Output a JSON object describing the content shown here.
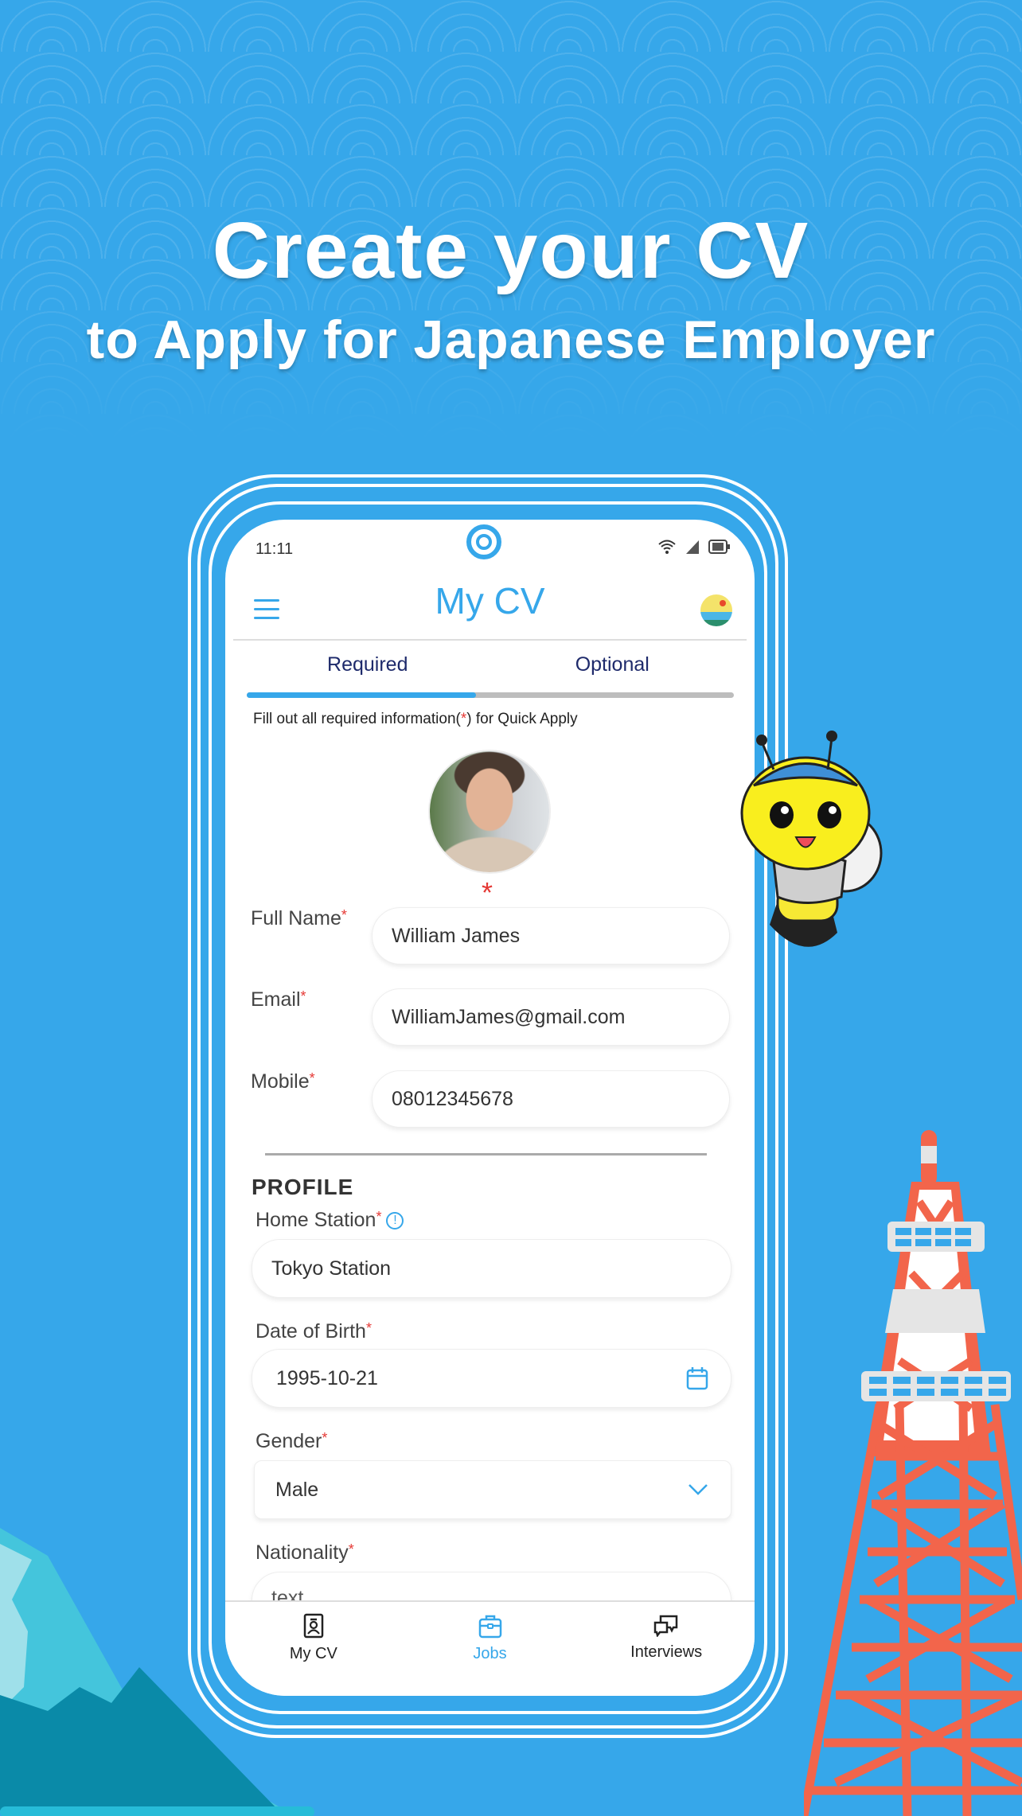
{
  "promo": {
    "headline": "Create your CV",
    "subheadline": "to Apply for Japanese Employer"
  },
  "status_bar": {
    "time": "11:11",
    "icons": [
      "wifi-icon",
      "signal-icon",
      "battery-icon"
    ]
  },
  "header": {
    "title": "My CV",
    "menu_icon": "hamburger-menu-icon",
    "logo_icon": "app-logo-icon"
  },
  "tabs": [
    {
      "label": "Required",
      "active": true
    },
    {
      "label": "Optional",
      "active": false
    }
  ],
  "progress": {
    "percent": 47
  },
  "helper": {
    "prefix": "Fill out all required information(",
    "marker": "*",
    "suffix": ") for Quick Apply"
  },
  "avatar": {
    "required_marker": "*"
  },
  "fields": {
    "full_name": {
      "label": "Full Name",
      "required": "*",
      "value": "William James"
    },
    "email": {
      "label": "Email",
      "required": "*",
      "value": "WilliamJames@gmail.com"
    },
    "mobile": {
      "label": "Mobile",
      "required": "*",
      "value": "08012345678"
    }
  },
  "profile": {
    "section_title": "PROFILE",
    "home_station": {
      "label": "Home Station",
      "required": "*",
      "value": "Tokyo Station",
      "info_icon": "!"
    },
    "date_of_birth": {
      "label": "Date of Birth",
      "required": "*",
      "value": "1995-10-21"
    },
    "gender": {
      "label": "Gender",
      "required": "*",
      "value": "Male"
    },
    "nationality": {
      "label": "Nationality",
      "required": "*",
      "placeholder": "text"
    }
  },
  "bottom_nav": [
    {
      "label": "My CV",
      "icon": "id-card-icon",
      "active": false
    },
    {
      "label": "Jobs",
      "icon": "briefcase-icon",
      "active": true
    },
    {
      "label": "Interviews",
      "icon": "chat-bubbles-icon",
      "active": false
    }
  ],
  "colors": {
    "background": "#36a7ea",
    "accent": "#36a7ea",
    "tab_text": "#1e2a6b",
    "required": "#e53935",
    "tower_red": "#f2654b"
  }
}
